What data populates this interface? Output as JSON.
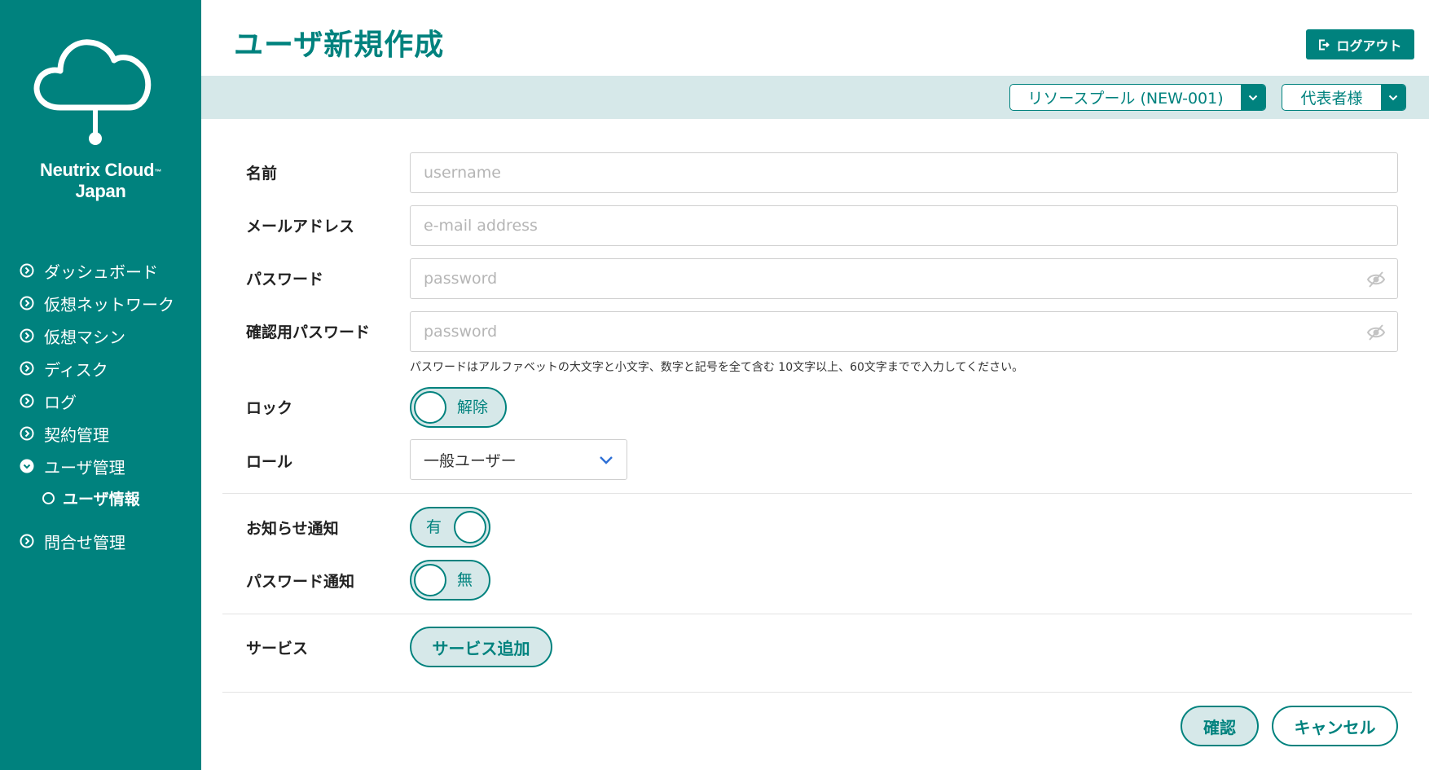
{
  "sidebar": {
    "brand_line1": "Neutrix Cloud",
    "brand_tm": "™",
    "brand_line2": "Japan",
    "items": [
      {
        "label": "ダッシュボード",
        "icon": "chevron-right-circle-icon"
      },
      {
        "label": "仮想ネットワーク",
        "icon": "chevron-right-circle-icon"
      },
      {
        "label": "仮想マシン",
        "icon": "chevron-right-circle-icon"
      },
      {
        "label": "ディスク",
        "icon": "chevron-right-circle-icon"
      },
      {
        "label": "ログ",
        "icon": "chevron-right-circle-icon"
      },
      {
        "label": "契約管理",
        "icon": "chevron-right-circle-icon"
      },
      {
        "label": "ユーザ管理",
        "icon": "chevron-down-circle-icon"
      },
      {
        "label": "問合せ管理",
        "icon": "chevron-right-circle-icon"
      }
    ],
    "subitem": {
      "label": "ユーザ情報",
      "icon": "ring-icon"
    }
  },
  "header": {
    "title": "ユーザ新規作成",
    "logout_label": "ログアウト",
    "resource_pool": "リソースプール (NEW-001)",
    "user_menu": "代表者様"
  },
  "form": {
    "name": {
      "label": "名前",
      "placeholder": "username",
      "value": ""
    },
    "email": {
      "label": "メールアドレス",
      "placeholder": "e-mail address",
      "value": ""
    },
    "password": {
      "label": "パスワード",
      "placeholder": "password",
      "value": ""
    },
    "confirm_password": {
      "label": "確認用パスワード",
      "placeholder": "password",
      "value": ""
    },
    "password_hint": "パスワードはアルファベットの大文字と小文字、数字と記号を全て含む 10文字以上、60文字までで入力してください。",
    "lock": {
      "label": "ロック",
      "state": "解除"
    },
    "role": {
      "label": "ロール",
      "value": "一般ユーザー"
    },
    "news_notify": {
      "label": "お知らせ通知",
      "state": "有"
    },
    "password_notify": {
      "label": "パスワード通知",
      "state": "無"
    },
    "service": {
      "label": "サービス",
      "add_label": "サービス追加"
    }
  },
  "actions": {
    "confirm_label": "確認",
    "cancel_label": "キャンセル"
  },
  "colors": {
    "accent": "#00827e",
    "band": "#d6e8e9"
  }
}
